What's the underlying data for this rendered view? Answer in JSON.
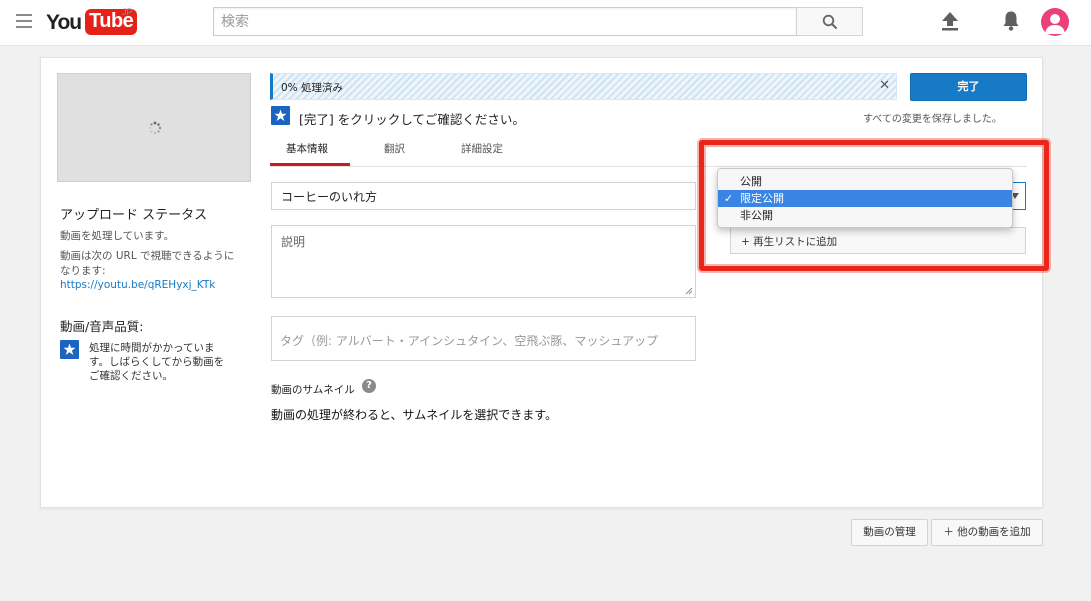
{
  "header": {
    "logo_you": "You",
    "logo_tube": "Tube",
    "logo_region": "JP",
    "search_placeholder": "検索"
  },
  "upload": {
    "progress_text": "0% 処理済み",
    "progress_percent": 0,
    "done_label": "完了",
    "confirm_text": "[完了] をクリックしてご確認ください。",
    "saved_text": "すべての変更を保存しました。"
  },
  "sidebar": {
    "status_title": "アップロード ステータス",
    "processing_text": "動画を処理しています。",
    "url_text_line1": "動画は次の URL で視聴できるように",
    "url_text_line2": "なります:",
    "video_url": "https://youtu.be/qREHyxj_KTk",
    "quality_title": "動画/音声品質:",
    "quality_note_line1": "処理に時間がかかっていま",
    "quality_note_line2": "す。しばらくしてから動画を",
    "quality_note_line3": "ご確認ください。"
  },
  "tabs": [
    {
      "label": "基本情報",
      "active": true
    },
    {
      "label": "翻訳",
      "active": false
    },
    {
      "label": "詳細設定",
      "active": false
    }
  ],
  "form": {
    "title_value": "コーヒーのいれ方",
    "description_placeholder": "説明",
    "tags_placeholder": "タグ（例: アルバート・アインシュタイン、空飛ぶ豚、マッシュアップ",
    "thumbnail_label": "動画のサムネイル",
    "thumbnail_help": "?",
    "thumbnail_note": "動画の処理が終わると、サムネイルを選択できます。"
  },
  "privacy": {
    "options": [
      "公開",
      "限定公開",
      "非公開"
    ],
    "selected": "限定公開",
    "check_glyph": "✓",
    "playlist_label": "+ 再生リストに追加"
  },
  "footer": {
    "manage_label": "動画の管理",
    "add_more_label": "＋ 他の動画を追加"
  },
  "colors": {
    "accent": "#167ac6",
    "brand_red": "#e62117",
    "highlight_red": "#e8261a",
    "selection": "#3a84e4"
  }
}
